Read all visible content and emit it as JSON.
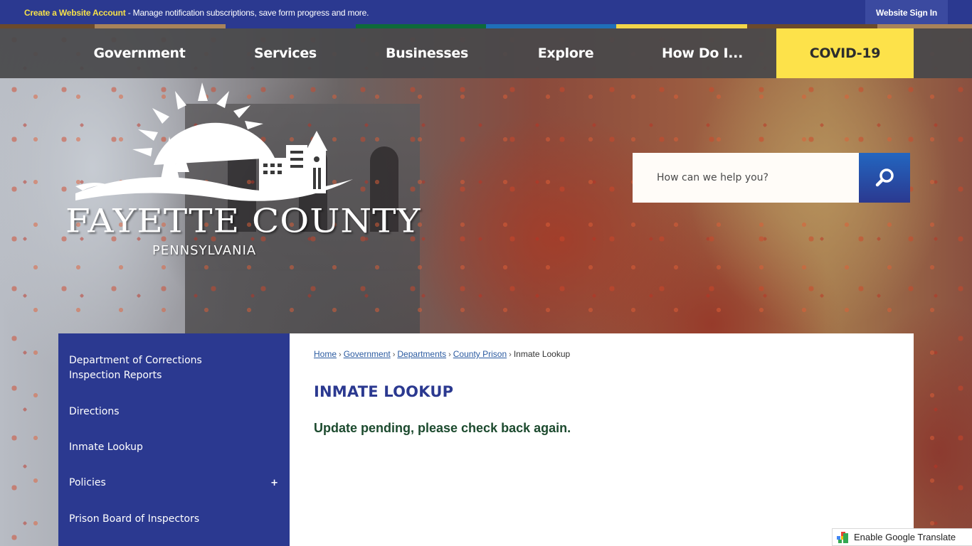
{
  "topbar": {
    "account_link": "Create a Website Account",
    "account_message": " - Manage notification subscriptions, save form progress and more.",
    "sign_in": "Website Sign In"
  },
  "stripe_colors": [
    "#6b4a2c",
    "#a8835a",
    "#2b3990",
    "#0e6a3a",
    "#1f6fb8",
    "#f2d54a",
    "#6b4a2c",
    "#a8835a"
  ],
  "nav": {
    "items": [
      {
        "label": "Government"
      },
      {
        "label": "Services"
      },
      {
        "label": "Businesses"
      },
      {
        "label": "Explore"
      },
      {
        "label": "How Do I..."
      },
      {
        "label": "COVID-19"
      }
    ]
  },
  "logo": {
    "name": "FAYETTE COUNTY",
    "state": "PENNSYLVANIA"
  },
  "search": {
    "placeholder": "How can we help you?",
    "value": ""
  },
  "sidebar": {
    "items": [
      {
        "label": "Department of Corrections Inspection Reports",
        "expandable": false
      },
      {
        "label": "Directions",
        "expandable": false
      },
      {
        "label": "Inmate Lookup",
        "expandable": false
      },
      {
        "label": "Policies",
        "expandable": true
      },
      {
        "label": "Prison Board of Inspectors",
        "expandable": false
      }
    ],
    "expand_symbol": "+"
  },
  "breadcrumb": {
    "items": [
      "Home",
      "Government",
      "Departments",
      "County Prison"
    ],
    "current": "Inmate Lookup",
    "separator": "›"
  },
  "page": {
    "title": "INMATE LOOKUP",
    "notice": "Update pending, please check back again."
  },
  "translate": {
    "label": "Enable Google Translate"
  },
  "colors": {
    "brand_blue": "#2b3990",
    "accent_yellow": "#fde24a",
    "notice_green": "#1c4a2e",
    "link_blue": "#2a5aa0"
  }
}
